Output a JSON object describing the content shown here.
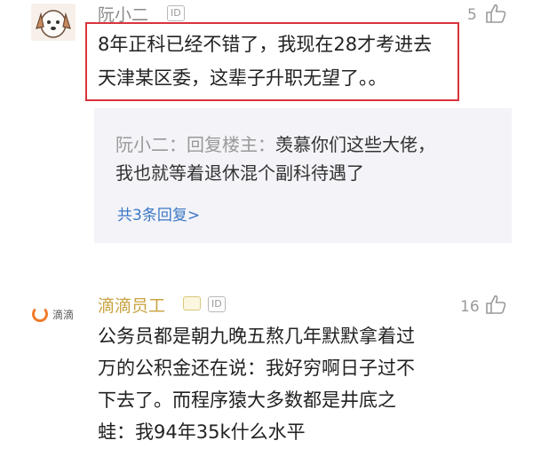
{
  "comment1": {
    "username": "阮小二",
    "id_badge": "ID",
    "like_count": "5",
    "lines": [
      "8年正科已经不错了，我现在28才考进去",
      "天津某区委，这辈子升职无望了。。"
    ],
    "reply": {
      "author": "阮小二：回复楼主：",
      "line1": "羡慕你们这些大佬，",
      "line2": "我也就等着退休混个副科待遇了",
      "more_link": "共3条回复>"
    }
  },
  "comment2": {
    "avatar_text": "滴滴",
    "username": "滴滴员工",
    "id_badge": "ID",
    "like_count": "16",
    "lines": [
      "公务员都是朝九晚五熬几年默默拿着过",
      "万的公积金还在说：我好穷啊日子过不",
      "下去了。而程序猿大多数都是井底之",
      "蛙：我94年35k什么水平"
    ]
  },
  "colors": {
    "highlight_border": "#d8333d",
    "reply_background": "#f3f3f8",
    "link": "#3b78c5",
    "gold_username": "#c9a341",
    "didi_orange": "#f27a2a"
  }
}
